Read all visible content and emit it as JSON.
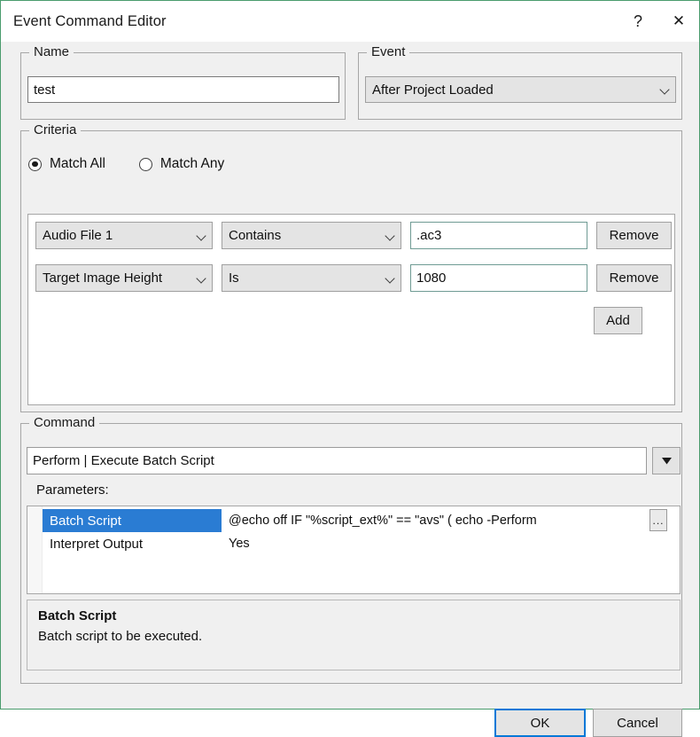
{
  "window": {
    "title": "Event Command Editor",
    "help_icon": "question-mark-icon",
    "close_icon": "close-icon",
    "accent_border": "#4a9c6d"
  },
  "name_group": {
    "legend": "Name",
    "value": "test",
    "placeholder": ""
  },
  "event_group": {
    "legend": "Event",
    "selected": "After Project Loaded",
    "chevron_icon": "chevron-down-icon"
  },
  "criteria": {
    "legend": "Criteria",
    "match_mode": {
      "selected": "Match All",
      "options": [
        {
          "label": "Match All",
          "checked": true
        },
        {
          "label": "Match Any",
          "checked": false
        }
      ]
    },
    "rows": [
      {
        "field": "Audio File 1",
        "operator": "Contains",
        "value": ".ac3",
        "remove_label": "Remove"
      },
      {
        "field": "Target Image Height",
        "operator": "Is",
        "value": "1080",
        "remove_label": "Remove"
      }
    ],
    "add_label": "Add"
  },
  "command": {
    "legend": "Command",
    "selected": "Perform | Execute Batch Script",
    "dropdown_icon": "triangle-down-icon",
    "parameters_label": "Parameters:",
    "parameters": [
      {
        "name": "Batch Script",
        "value": "@echo off IF \"%script_ext%\" == \"avs\" (    echo -Perform",
        "selected": true,
        "has_browse": true,
        "browse_label": "..."
      },
      {
        "name": "Interpret Output",
        "value": "Yes",
        "selected": false,
        "has_browse": false,
        "browse_label": ""
      }
    ],
    "description": {
      "title": "Batch Script",
      "text": "Batch script to be executed."
    }
  },
  "footer": {
    "ok_label": "OK",
    "cancel_label": "Cancel"
  },
  "colors": {
    "selection_blue": "#2a7cd3",
    "focus_blue": "#0078d7",
    "dialog_bg": "#f0f0f0"
  }
}
